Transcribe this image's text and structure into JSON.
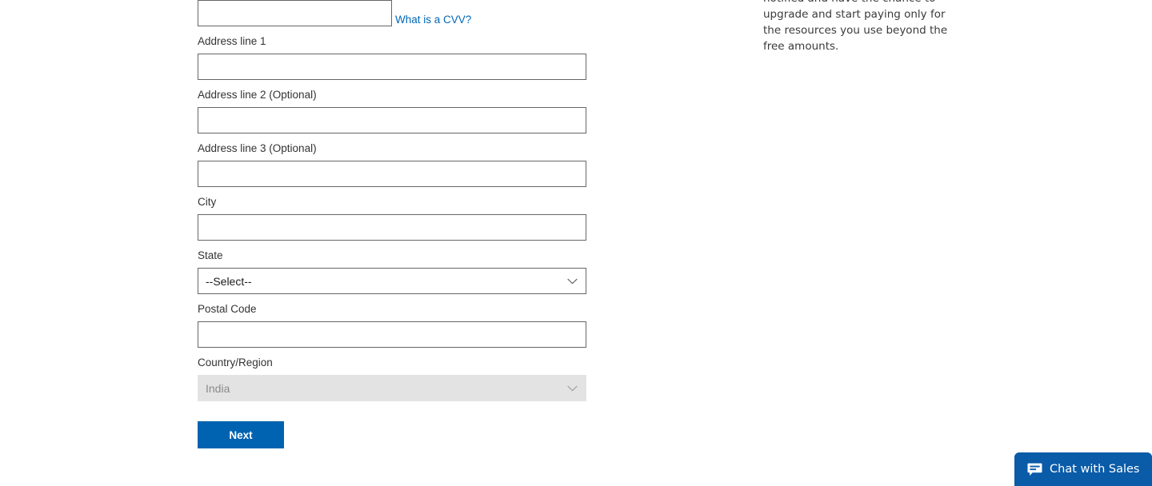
{
  "form": {
    "cvv": {
      "name": "cvv",
      "value": "",
      "placeholder": "",
      "help_link": "What is a CVV?"
    },
    "fields": [
      {
        "name": "address-line-1",
        "label": "Address line 1",
        "type": "text",
        "value": "",
        "placeholder": ""
      },
      {
        "name": "address-line-2",
        "label": "Address line 2 (Optional)",
        "type": "text",
        "value": "",
        "placeholder": ""
      },
      {
        "name": "address-line-3",
        "label": "Address line 3 (Optional)",
        "type": "text",
        "value": "",
        "placeholder": ""
      },
      {
        "name": "city",
        "label": "City",
        "type": "text",
        "value": "",
        "placeholder": ""
      },
      {
        "name": "state",
        "label": "State",
        "type": "select",
        "value": "--Select--",
        "disabled": false
      },
      {
        "name": "postal-code",
        "label": "Postal Code",
        "type": "text",
        "value": "",
        "placeholder": ""
      },
      {
        "name": "country-region",
        "label": "Country/Region",
        "type": "select",
        "value": "India",
        "disabled": true
      }
    ],
    "submit_label": "Next"
  },
  "info_panel": {
    "text": "notified and have the chance to upgrade and start paying only for the resources you use beyond the free amounts."
  },
  "chat": {
    "label": "Chat with Sales",
    "icon": "chat-bubble-icon"
  },
  "colors": {
    "accent_blue": "#0063b1",
    "link_blue": "#0067b8",
    "chat_blue": "#0a5ba8",
    "border_gray": "#666666",
    "disabled_bg": "#e3e3e3",
    "disabled_text": "#8a8a8a",
    "label_text": "#333333"
  },
  "icons": {
    "chevron_down": "chevron-down-icon"
  }
}
